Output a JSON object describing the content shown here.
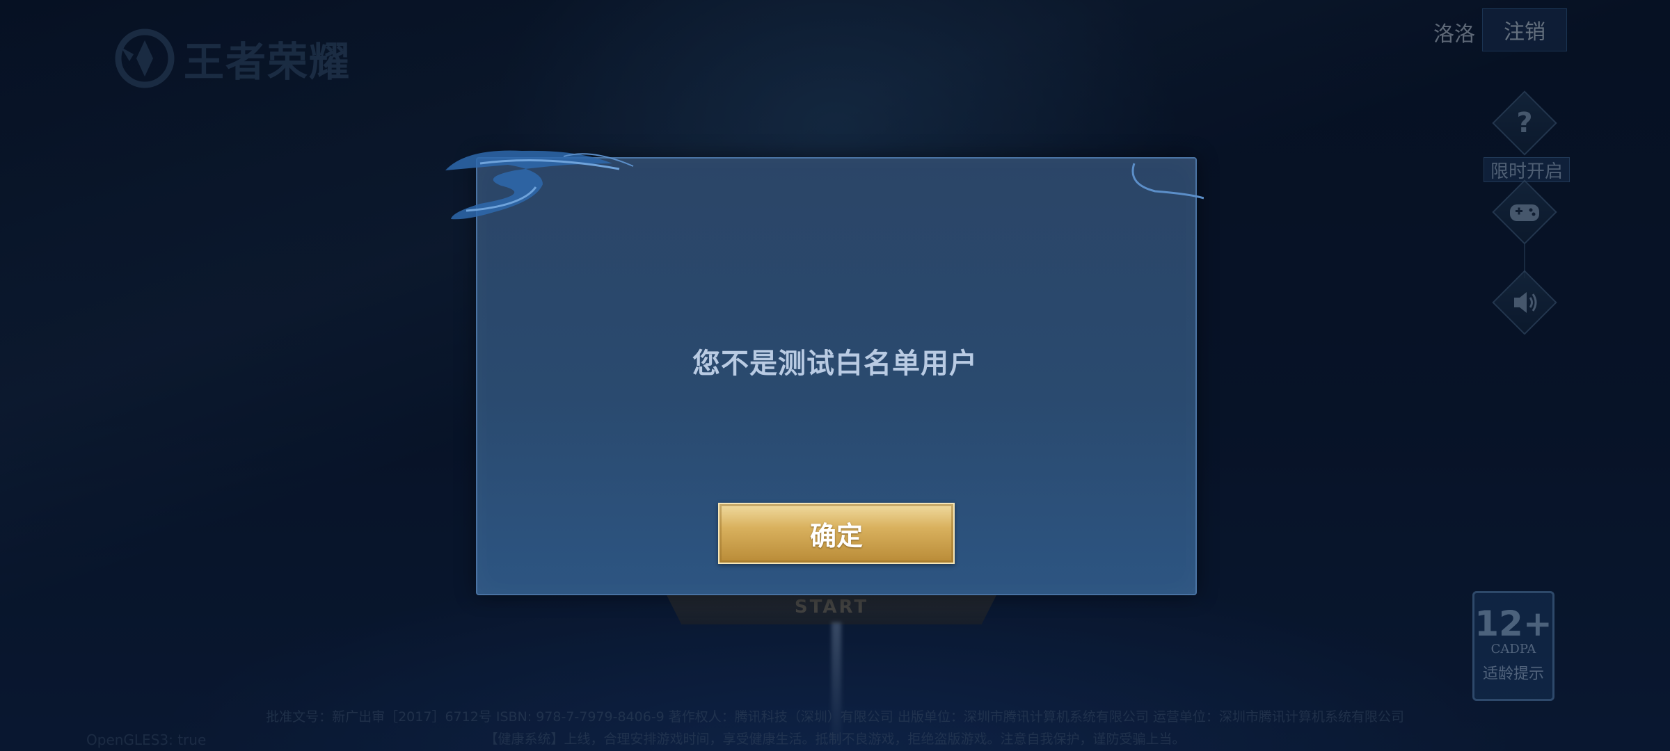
{
  "header": {
    "logo_text": "王者荣耀",
    "user_name": "洛洛",
    "logout_label": "注销"
  },
  "side_menu": {
    "help_icon": "question-diamond-icon",
    "limited_label": "限时开启",
    "gamepad_icon": "gamepad-icon",
    "sound_icon": "speaker-icon"
  },
  "age_rating": {
    "age": "12+",
    "org": "CADPA",
    "hint": "适龄提示"
  },
  "background": {
    "start_label": "START"
  },
  "modal": {
    "message": "您不是测试白名单用户",
    "confirm_label": "确定"
  },
  "footer": {
    "line1": "批准文号：新广出审［2017］6712号 ISBN: 978-7-7979-8406-9 著作权人：腾讯科技（深圳）有限公司 出版单位：深圳市腾讯计算机系统有限公司 运营单位：深圳市腾讯计算机系统有限公司",
    "line2": "【健康系统】上线，合理安排游戏时间，享受健康生活。抵制不良游戏，拒绝盗版游戏。注意自我保护，谨防受骗上当。",
    "opengl": "OpenGLES3: true"
  },
  "colors": {
    "modal_bg": "#2b4567",
    "button_gold": "#d9b15e",
    "text_light": "#b9cbe3"
  }
}
